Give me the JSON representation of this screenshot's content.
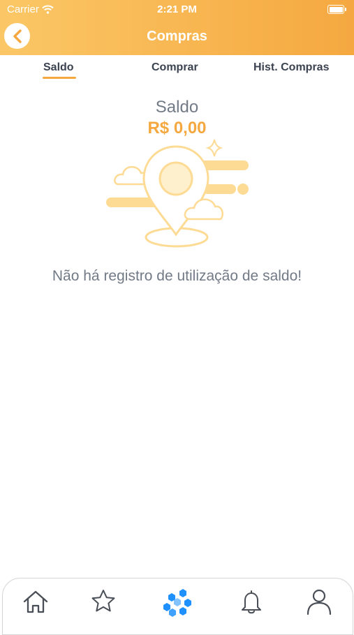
{
  "status_bar": {
    "carrier": "Carrier",
    "time": "2:21 PM"
  },
  "header": {
    "title": "Compras",
    "back_icon": "chevron-left-icon"
  },
  "tabs": [
    {
      "label": "Saldo",
      "active": true
    },
    {
      "label": "Comprar",
      "active": false
    },
    {
      "label": "Hist. Compras",
      "active": false
    }
  ],
  "balance": {
    "label": "Saldo",
    "value": "R$ 0,00"
  },
  "empty_state": {
    "message": "Não há registro de utilização de saldo!",
    "illustration": "location-pin-clouds"
  },
  "bottom_nav": [
    {
      "icon": "home-icon"
    },
    {
      "icon": "star-icon"
    },
    {
      "icon": "hexagon-cluster-icon",
      "active": true
    },
    {
      "icon": "bell-icon"
    },
    {
      "icon": "user-icon"
    }
  ],
  "colors": {
    "accent": "#f5a840",
    "header_start": "#fbc766",
    "text_gray": "#727a86",
    "tab_text": "#3b4250",
    "active_nav": "#1e90ff"
  }
}
